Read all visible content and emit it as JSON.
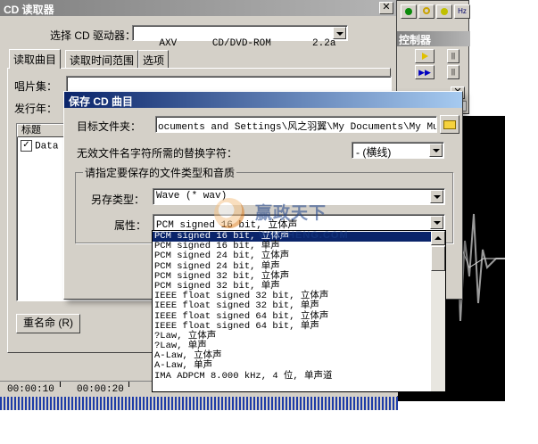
{
  "reader": {
    "title": "CD 读取器",
    "drive_label": "选择 CD 驱动器：",
    "drive_value": "AXV      CD/DVD-ROM       2.2a",
    "tabs": [
      "读取曲目",
      "读取时间范围",
      "选项"
    ],
    "album_label": "唱片集：",
    "publisher_label": "发行年：",
    "title_column": "标题",
    "track_item": "Data T",
    "rename_button": "重名命 (R)"
  },
  "timeline": {
    "times": [
      "00:00:10",
      "00:00:20"
    ]
  },
  "controller": {
    "title": "控制器"
  },
  "save_dialog": {
    "title": "保存 CD 曲目",
    "target_folder_label": "目标文件夹：",
    "target_folder_value": "ocuments and Settings\\风之羽翼\\My Documents\\My Music",
    "invalid_chars_label": "无效文件名字符所需的替换字符：",
    "invalid_chars_value": "- (横线)",
    "group_label": "请指定要保存的文件类型和音质",
    "save_type_label": "另存类型：",
    "save_type_value": "Wave (* wav)",
    "attributes_label": "属性：",
    "attributes_value": "PCM signed 16 bit, 立体声",
    "attribute_options": [
      "PCM signed 16 bit, 立体声",
      "PCM signed 16 bit, 单声",
      "PCM signed 24 bit, 立体声",
      "PCM signed 24 bit, 单声",
      "PCM signed 32 bit, 立体声",
      "PCM signed 32 bit, 单声",
      "IEEE float signed 32 bit, 立体声",
      "IEEE float signed 32 bit, 单声",
      "IEEE float signed 64 bit, 立体声",
      "IEEE float signed 64 bit, 单声",
      "?Law, 立体声",
      "?Law, 单声",
      "A-Law, 立体声",
      "A-Law, 单声",
      "IMA ADPCM 8.000 kHz, 4 位, 单声道"
    ],
    "selected_index": 0
  },
  "watermark": {
    "text": "赢政天下",
    "url": "WINZHENG.COM"
  },
  "colors": {
    "title_active": "#0a246a",
    "title_inactive": "#808080",
    "face": "#d4d0c8",
    "selection": "#0a246a"
  }
}
